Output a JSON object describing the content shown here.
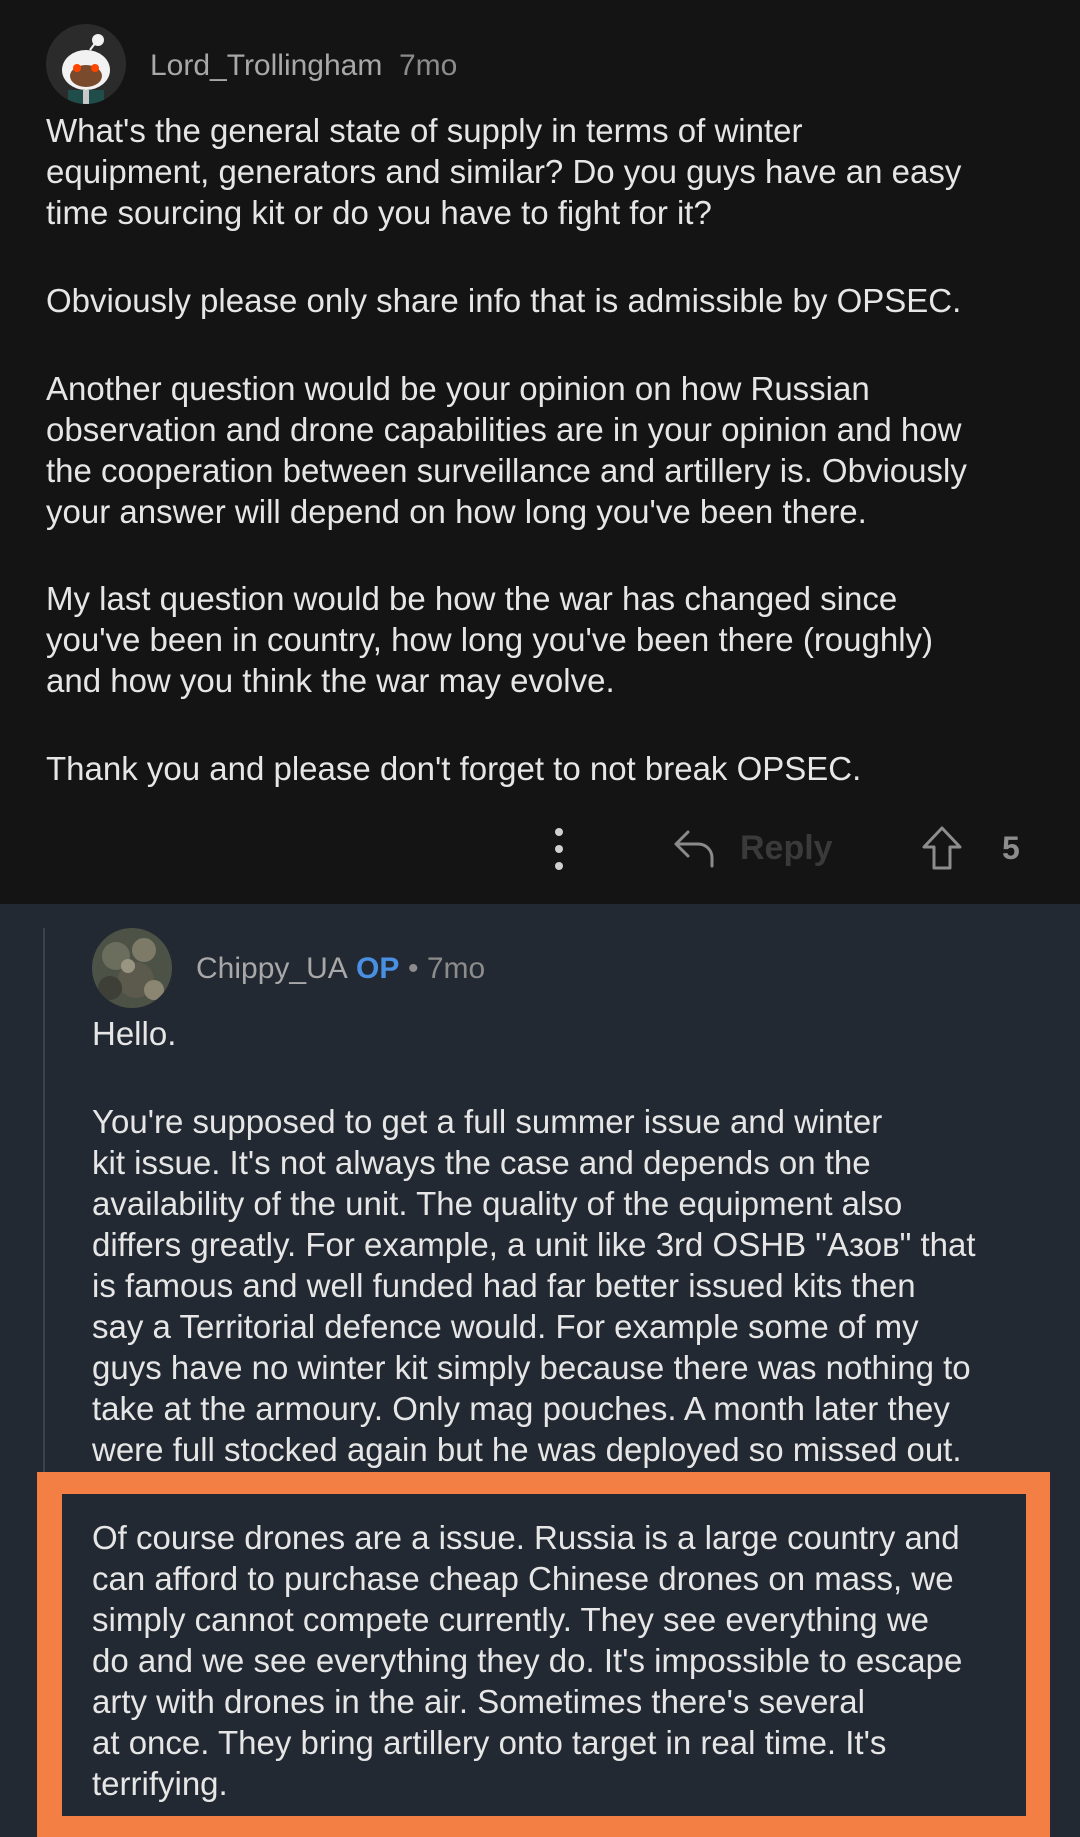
{
  "parent_comment": {
    "author": "Lord_Trollingham",
    "age": "7mo",
    "paragraphs": [
      [
        "What's the general state of supply in terms of winter",
        "equipment, generators and similar? Do you guys have an easy",
        "time sourcing kit or do you have to fight for it?"
      ],
      [
        "Obviously please only share info that is admissible by OPSEC."
      ],
      [
        "Another question would be your opinion on how Russian",
        "observation and drone capabilities are in your opinion and how",
        "the cooperation between surveillance and artillery is. Obviously",
        "your answer will depend on how long you've been there."
      ],
      [
        "My last question would be how the war has changed since",
        "you've been in country, how long you've been there (roughly)",
        "and how you think the war may evolve."
      ],
      [
        "Thank you and please don't forget to not break OPSEC."
      ]
    ],
    "actions": {
      "more_icon": "more-vertical-icon",
      "reply_label": "Reply",
      "reply_icon": "reply-arrow-icon",
      "upvote_icon": "upvote-arrow-icon",
      "vote_count": "5"
    }
  },
  "reply_comment": {
    "author": "Chippy_UA",
    "op_badge": "OP",
    "age": "• 7mo",
    "paragraphs": [
      [
        "Hello."
      ],
      [
        "You're supposed to get a full summer issue and winter",
        "kit issue. It's not always the case and depends on the",
        "availability of the unit. The quality of the equipment also",
        "differs greatly. For example, a unit like 3rd OSHB \"Азов\" that",
        "is famous and well funded had far better issued kits then",
        "say a Territorial defence would. For example some of my",
        "guys have no winter kit simply because there was nothing to",
        "take at the armoury. Only mag pouches. A month later they",
        "were full stocked again but he was deployed so missed out."
      ],
      [
        "Of course drones are a issue. Russia is a large country and",
        "can afford to purchase cheap Chinese drones on mass, we",
        "simply cannot compete currently. They see everything we",
        "do and we see everything they do. It's impossible to escape",
        "arty with drones in the air. Sometimes there's several",
        "at once. They bring artillery onto target in real time. It's",
        "terrifying."
      ]
    ]
  },
  "colors": {
    "parent_bg": "#141414",
    "reply_bg": "#232932",
    "highlight": "#f47f45",
    "op_badge": "#4a90e2",
    "body_text": "#e6e6e6"
  }
}
